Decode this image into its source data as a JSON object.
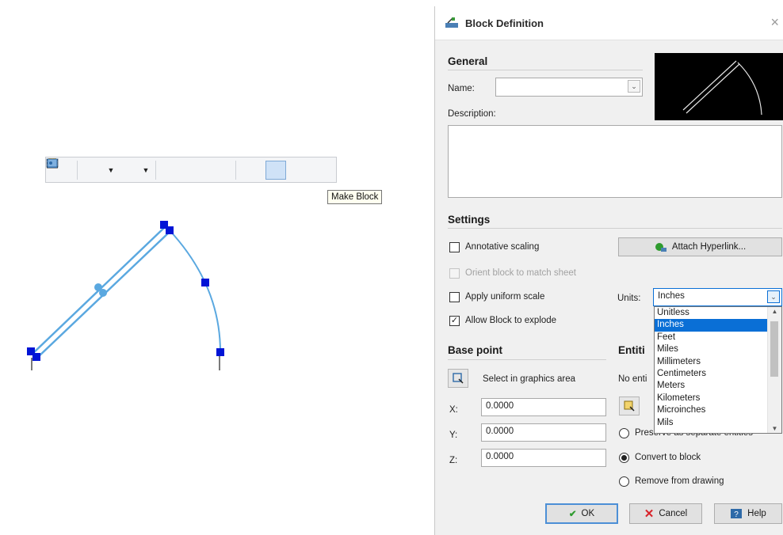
{
  "toolbar": {
    "tooltip": "Make Block",
    "buttons": [
      "zoom-icon",
      "layer-icon",
      "lineweight-icon",
      "properties-icon",
      "match-icon",
      "lock-icon",
      "insert-icon",
      "make-block-icon"
    ]
  },
  "dialog": {
    "title": "Block Definition",
    "close": "×",
    "general": {
      "heading": "General",
      "name_label": "Name:",
      "name_value": "",
      "description_label": "Description:",
      "description_value": ""
    },
    "settings": {
      "heading": "Settings",
      "annotative_label": "Annotative scaling",
      "annotative_checked": false,
      "orient_label": "Orient block to match sheet",
      "orient_enabled": false,
      "uniform_label": "Apply uniform scale",
      "uniform_checked": false,
      "explode_label": "Allow Block to explode",
      "explode_checked": true,
      "hyperlink_button": "Attach Hyperlink...",
      "units_label": "Units:",
      "units_value": "Inches",
      "units_options": [
        "Unitless",
        "Inches",
        "Feet",
        "Miles",
        "Millimeters",
        "Centimeters",
        "Meters",
        "Kilometers",
        "Microinches",
        "Mils"
      ],
      "units_selected_index": 1
    },
    "base_point": {
      "heading": "Base point",
      "select_label": "Select in graphics area",
      "x_label": "X:",
      "x_value": "0.0000",
      "y_label": "Y:",
      "y_value": "0.0000",
      "z_label": "Z:",
      "z_value": "0.0000"
    },
    "entities": {
      "heading": "Entiti",
      "none_label": "No enti",
      "preserve_label": "Preserve as separate entities",
      "convert_label": "Convert to block",
      "remove_label": "Remove from drawing",
      "selected_option": "convert"
    },
    "buttons": {
      "ok": "OK",
      "cancel": "Cancel",
      "help": "Help"
    },
    "colors": {
      "accent": "#0a6fd6",
      "ok_check": "#2e9b2e",
      "cancel_x": "#d8232a",
      "grip": "#0014d6",
      "selection": "#5aa8e0"
    }
  }
}
